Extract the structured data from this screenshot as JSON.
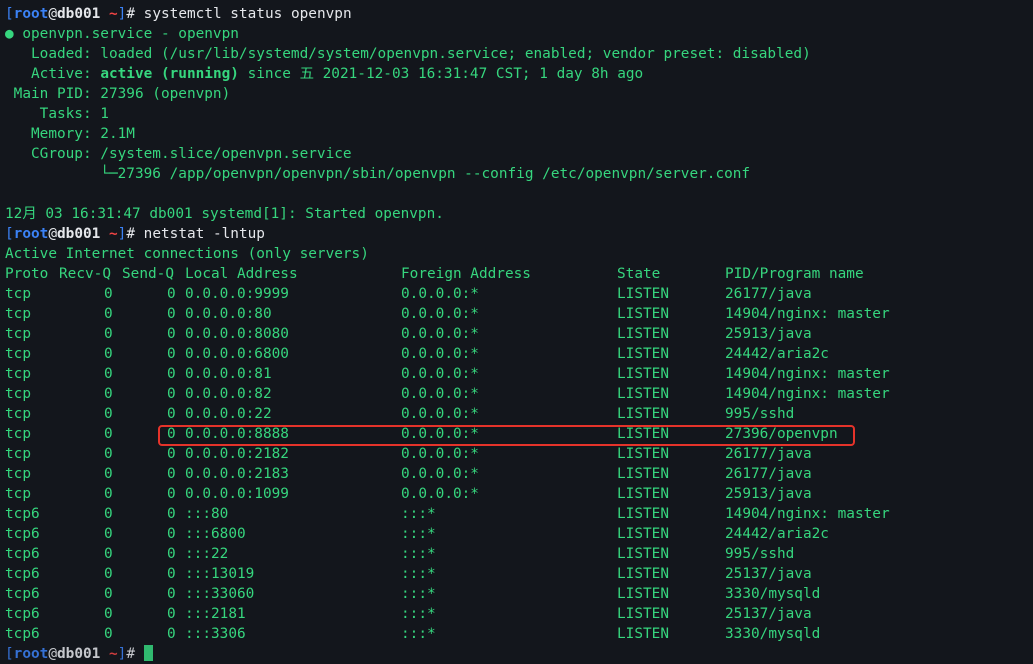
{
  "prompt": {
    "open_bracket": "[",
    "user": "root",
    "at": "@",
    "host": "db001",
    "space": " ",
    "path": "~",
    "close_bracket": "]",
    "hash": "# "
  },
  "commands": {
    "first": "systemctl status openvpn",
    "second": "netstat -lntup"
  },
  "status": {
    "title": "● openvpn.service - openvpn",
    "loaded": "   Loaded: loaded (/usr/lib/systemd/system/openvpn.service; enabled; vendor preset: disabled)",
    "active_label": "   Active: ",
    "active_state": "active (running)",
    "active_rest": " since 五 2021-12-03 16:31:47 CST; 1 day 8h ago",
    "main_pid": " Main PID: 27396 (openvpn)",
    "tasks": "    Tasks: 1",
    "memory": "   Memory: 2.1M",
    "cgroup": "   CGroup: /system.slice/openvpn.service",
    "cgroup_child": "           └─27396 /app/openvpn/openvpn/sbin/openvpn --config /etc/openvpn/server.conf",
    "blank": "",
    "log": "12月 03 16:31:47 db001 systemd[1]: Started openvpn."
  },
  "netstat": {
    "heading": "Active Internet connections (only servers)",
    "headers": {
      "proto": "Proto",
      "recvq": "Recv-Q",
      "sendq": "Send-Q",
      "local": "Local Address",
      "foreign": "Foreign Address",
      "state": "State",
      "pid": "PID/Program name"
    },
    "rows": [
      {
        "proto": "tcp",
        "recvq": "0",
        "sendq": "0",
        "local": "0.0.0.0:9999",
        "foreign": "0.0.0.0:*",
        "state": "LISTEN",
        "pid": "26177/java"
      },
      {
        "proto": "tcp",
        "recvq": "0",
        "sendq": "0",
        "local": "0.0.0.0:80",
        "foreign": "0.0.0.0:*",
        "state": "LISTEN",
        "pid": "14904/nginx: master"
      },
      {
        "proto": "tcp",
        "recvq": "0",
        "sendq": "0",
        "local": "0.0.0.0:8080",
        "foreign": "0.0.0.0:*",
        "state": "LISTEN",
        "pid": "25913/java"
      },
      {
        "proto": "tcp",
        "recvq": "0",
        "sendq": "0",
        "local": "0.0.0.0:6800",
        "foreign": "0.0.0.0:*",
        "state": "LISTEN",
        "pid": "24442/aria2c"
      },
      {
        "proto": "tcp",
        "recvq": "0",
        "sendq": "0",
        "local": "0.0.0.0:81",
        "foreign": "0.0.0.0:*",
        "state": "LISTEN",
        "pid": "14904/nginx: master"
      },
      {
        "proto": "tcp",
        "recvq": "0",
        "sendq": "0",
        "local": "0.0.0.0:82",
        "foreign": "0.0.0.0:*",
        "state": "LISTEN",
        "pid": "14904/nginx: master"
      },
      {
        "proto": "tcp",
        "recvq": "0",
        "sendq": "0",
        "local": "0.0.0.0:22",
        "foreign": "0.0.0.0:*",
        "state": "LISTEN",
        "pid": "995/sshd"
      },
      {
        "proto": "tcp",
        "recvq": "0",
        "sendq": "0",
        "local": "0.0.0.0:8888",
        "foreign": "0.0.0.0:*",
        "state": "LISTEN",
        "pid": "27396/openvpn"
      },
      {
        "proto": "tcp",
        "recvq": "0",
        "sendq": "0",
        "local": "0.0.0.0:2182",
        "foreign": "0.0.0.0:*",
        "state": "LISTEN",
        "pid": "26177/java"
      },
      {
        "proto": "tcp",
        "recvq": "0",
        "sendq": "0",
        "local": "0.0.0.0:2183",
        "foreign": "0.0.0.0:*",
        "state": "LISTEN",
        "pid": "26177/java"
      },
      {
        "proto": "tcp",
        "recvq": "0",
        "sendq": "0",
        "local": "0.0.0.0:1099",
        "foreign": "0.0.0.0:*",
        "state": "LISTEN",
        "pid": "25913/java"
      },
      {
        "proto": "tcp6",
        "recvq": "0",
        "sendq": "0",
        "local": ":::80",
        "foreign": ":::*",
        "state": "LISTEN",
        "pid": "14904/nginx: master"
      },
      {
        "proto": "tcp6",
        "recvq": "0",
        "sendq": "0",
        "local": ":::6800",
        "foreign": ":::*",
        "state": "LISTEN",
        "pid": "24442/aria2c"
      },
      {
        "proto": "tcp6",
        "recvq": "0",
        "sendq": "0",
        "local": ":::22",
        "foreign": ":::*",
        "state": "LISTEN",
        "pid": "995/sshd"
      },
      {
        "proto": "tcp6",
        "recvq": "0",
        "sendq": "0",
        "local": ":::13019",
        "foreign": ":::*",
        "state": "LISTEN",
        "pid": "25137/java"
      },
      {
        "proto": "tcp6",
        "recvq": "0",
        "sendq": "0",
        "local": ":::33060",
        "foreign": ":::*",
        "state": "LISTEN",
        "pid": "3330/mysqld"
      },
      {
        "proto": "tcp6",
        "recvq": "0",
        "sendq": "0",
        "local": ":::2181",
        "foreign": ":::*",
        "state": "LISTEN",
        "pid": "25137/java"
      },
      {
        "proto": "tcp6",
        "recvq": "0",
        "sendq": "0",
        "local": ":::3306",
        "foreign": ":::*",
        "state": "LISTEN",
        "pid": "3330/mysqld"
      }
    ],
    "highlighted_local": "0.0.0.0:8888"
  },
  "colors": {
    "background": "#13161c",
    "text_green": "#36d67e",
    "prompt_blue": "#3b82f6",
    "prompt_red": "#ef4444",
    "highlight_red": "#e5332a"
  }
}
